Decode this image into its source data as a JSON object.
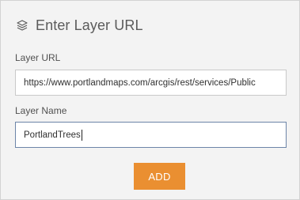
{
  "dialog": {
    "title": "Enter Layer URL",
    "title_icon": "layers-icon"
  },
  "form": {
    "layer_url": {
      "label": "Layer URL",
      "value": "https://www.portlandmaps.com/arcgis/rest/services/Public"
    },
    "layer_name": {
      "label": "Layer Name",
      "value": "PortlandTrees"
    }
  },
  "actions": {
    "add_label": "ADD"
  },
  "colors": {
    "panel_background": "#f3f3f3",
    "accent_button": "#ea8f31",
    "focused_input_border": "#6d85a8"
  }
}
